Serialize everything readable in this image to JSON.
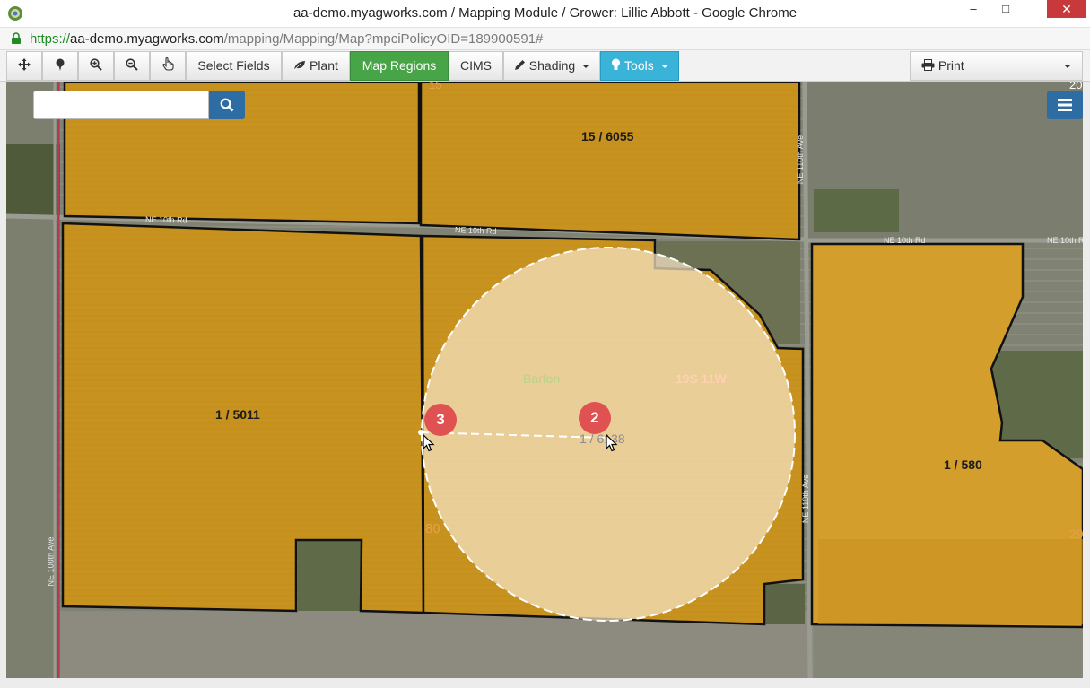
{
  "window": {
    "title": "aa-demo.myagworks.com / Mapping Module / Grower: Lillie Abbott - Google Chrome",
    "minimize": "–",
    "maximize": "□",
    "close": "✕"
  },
  "address": {
    "scheme": "https://",
    "host": "aa-demo.myagworks.com",
    "path": "/mapping/Mapping/Map?mpciPolicyOID=189900591#"
  },
  "toolbar": {
    "select_fields": "Select Fields",
    "plant": "Plant",
    "map_regions": "Map Regions",
    "cims": "CIMS",
    "shading": "Shading",
    "tools": "Tools",
    "print": "Print"
  },
  "colors": {
    "map_regions_bg": "#47a447",
    "tools_bg": "#39b3d7",
    "field_fill": "#c8921e",
    "search_btn": "#2e6da4",
    "badge": "#e05252"
  },
  "map": {
    "search": {
      "placeholder": "",
      "value": ""
    },
    "fields": [
      {
        "label": "15 / 6055"
      },
      {
        "label": "1 / 5011"
      },
      {
        "label": "1 / 6138"
      },
      {
        "label": "1 / 580"
      }
    ],
    "roads": {
      "ne_10th_rd_a": "NE 10th Rd",
      "ne_10th_rd_b": "NE 10th Rd",
      "ne_10th_rd_c": "NE 10th Rd",
      "ne_10th_rd_d": "NE 10th Rd",
      "ne_110th_ave_a": "NE 110th Ave",
      "ne_110th_ave_b": "NE 110th Ave",
      "ne_100th_ave": "NE 100th Ave"
    },
    "county_label": "Barton",
    "township_label": "19S 11W",
    "edge_labels": {
      "top": "15",
      "left_mid": "80",
      "right_top": "20",
      "right_mid": "29"
    },
    "badges": {
      "step3": "3",
      "step2": "2"
    }
  }
}
